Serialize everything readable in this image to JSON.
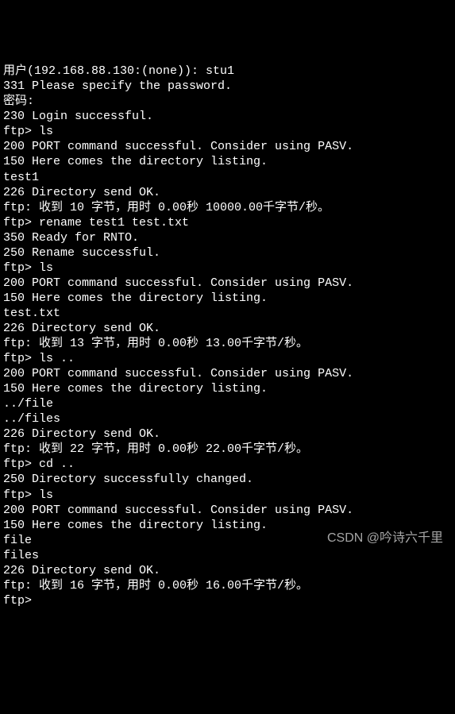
{
  "terminal": {
    "lines": [
      "用户(192.168.88.130:(none)): stu1",
      "331 Please specify the password.",
      "密码:",
      "230 Login successful.",
      "ftp> ls",
      "200 PORT command successful. Consider using PASV.",
      "150 Here comes the directory listing.",
      "test1",
      "226 Directory send OK.",
      "ftp: 收到 10 字节，用时 0.00秒 10000.00千字节/秒。",
      "ftp> rename test1 test.txt",
      "350 Ready for RNTO.",
      "250 Rename successful.",
      "ftp> ls",
      "200 PORT command successful. Consider using PASV.",
      "150 Here comes the directory listing.",
      "test.txt",
      "226 Directory send OK.",
      "ftp: 收到 13 字节，用时 0.00秒 13.00千字节/秒。",
      "ftp> ls ..",
      "200 PORT command successful. Consider using PASV.",
      "150 Here comes the directory listing.",
      "../file",
      "../files",
      "226 Directory send OK.",
      "ftp: 收到 22 字节，用时 0.00秒 22.00千字节/秒。",
      "ftp> cd ..",
      "250 Directory successfully changed.",
      "ftp> ls",
      "200 PORT command successful. Consider using PASV.",
      "150 Here comes the directory listing.",
      "file",
      "files",
      "226 Directory send OK.",
      "ftp: 收到 16 字节，用时 0.00秒 16.00千字节/秒。",
      "ftp>"
    ]
  },
  "watermark": "CSDN @吟诗六千里"
}
